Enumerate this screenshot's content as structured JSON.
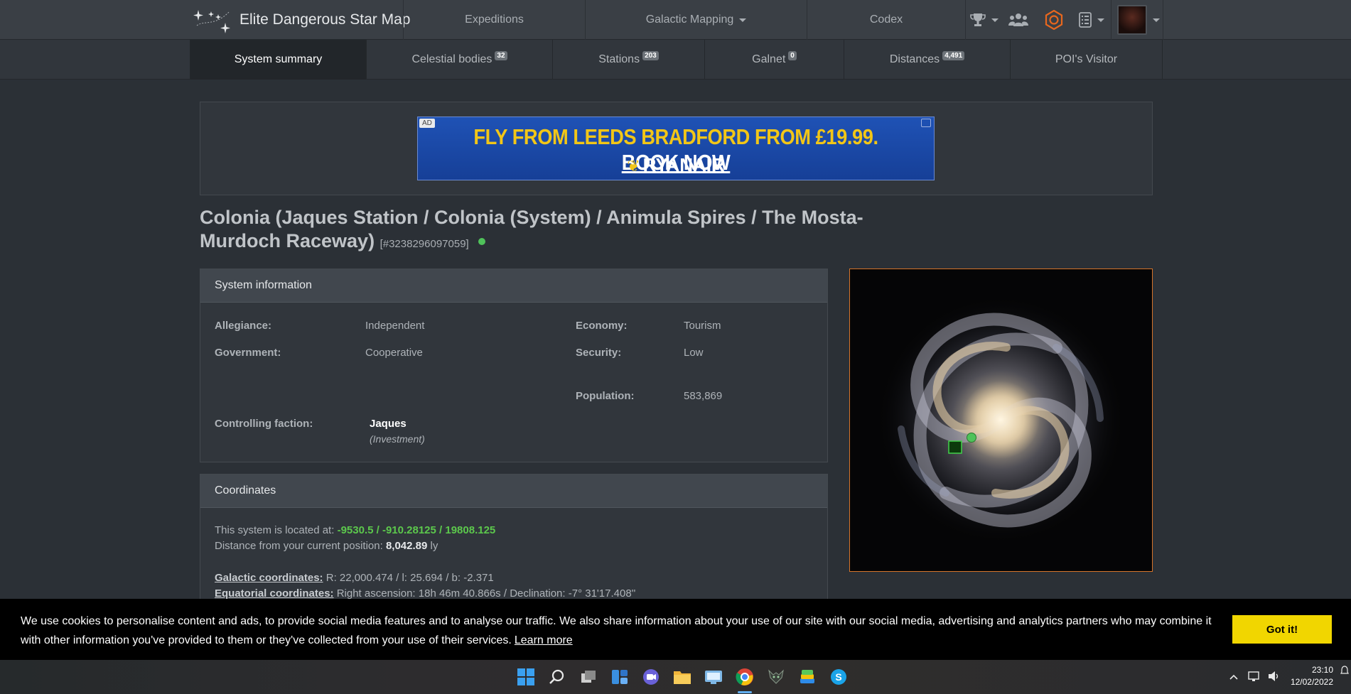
{
  "nav": {
    "brand": "Elite Dangerous Star Map",
    "items": [
      {
        "label": "Expeditions"
      },
      {
        "label": "Galactic Mapping"
      },
      {
        "label": "Codex"
      }
    ]
  },
  "tabs": [
    {
      "label": "System summary",
      "badge": null
    },
    {
      "label": "Celestial bodies",
      "badge": "32"
    },
    {
      "label": "Stations",
      "badge": "203"
    },
    {
      "label": "Galnet",
      "badge": "0"
    },
    {
      "label": "Distances",
      "badge": "4,491"
    },
    {
      "label": "POI's Visitor",
      "badge": null
    }
  ],
  "ad": {
    "tag": "AD",
    "headline": "FLY FROM LEEDS BRADFORD FROM £19.99.",
    "cta": "BOOK NOW",
    "brand": "RYANAIR"
  },
  "page": {
    "title": "Colonia (Jaques Station / Colonia (System) / Animula Spires / The Mosta-Murdoch Raceway)",
    "system_id": "[#3238296097059]"
  },
  "system_info": {
    "heading": "System information",
    "allegiance_label": "Allegiance:",
    "allegiance": "Independent",
    "economy_label": "Economy:",
    "economy": "Tourism",
    "government_label": "Government:",
    "government": "Cooperative",
    "security_label": "Security:",
    "security": "Low",
    "population_label": "Population:",
    "population": "583,869",
    "faction_label": "Controlling faction:",
    "faction_name": "Jaques",
    "faction_type": "(Investment)"
  },
  "coordinates": {
    "heading": "Coordinates",
    "located_prefix": "This system is located at:",
    "located_value": "-9530.5 / -910.28125 / 19808.125",
    "distance_prefix": "Distance from your current position:",
    "distance_value": "8,042.89",
    "distance_unit": "ly",
    "galactic_label": "Galactic coordinates:",
    "galactic_value": "R: 22,000.474 / l: 25.694 / b: -2.371",
    "equatorial_label": "Equatorial coordinates:",
    "equatorial_value": "Right ascension: 18h 46m 40.866s / Declination: -7° 31'17.408''"
  },
  "cookie": {
    "message": "We use cookies to personalise content and ads, to provide social media features and to analyse our traffic. We also share information about your use of our site with our social media, advertising and analytics partners who may combine it with other information you've provided to them or they've collected from your use of their services.",
    "learn_more": "Learn more",
    "button": "Got it!"
  },
  "taskbar": {
    "time": "23:10",
    "date": "12/02/2022",
    "icons": [
      "windows-start-icon",
      "search-icon",
      "task-view-icon",
      "widgets-icon",
      "teams-chat-icon",
      "file-explorer-icon",
      "control-panel-icon",
      "chrome-icon",
      "game-app-icon",
      "bluestacks-icon",
      "skype-icon"
    ]
  }
}
